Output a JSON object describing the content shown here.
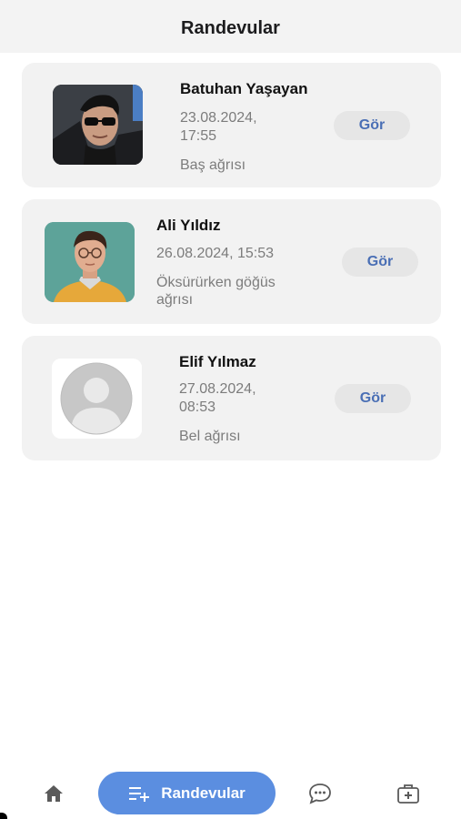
{
  "header": {
    "title": "Randevular"
  },
  "appointments": [
    {
      "name": "Batuhan Yaşayan",
      "datetime_line1": "23.08.2024,",
      "datetime_line2": "17:55",
      "complaint_line1": "Baş ağrısı",
      "complaint_line2": "",
      "button_label": "Gör"
    },
    {
      "name": "Ali Yıldız",
      "datetime_line1": "26.08.2024, 15:53",
      "datetime_line2": "",
      "complaint_line1": "Öksürürken göğüs",
      "complaint_line2": "ağrısı",
      "button_label": "Gör"
    },
    {
      "name": "Elif Yılmaz",
      "datetime_line1": "27.08.2024,",
      "datetime_line2": "08:53",
      "complaint_line1": "Bel ağrısı",
      "complaint_line2": "",
      "button_label": "Gör"
    }
  ],
  "tabbar": {
    "items": [
      {
        "icon": "home-icon"
      },
      {
        "icon": "add-list-icon",
        "label": "Randevular",
        "active": true
      },
      {
        "icon": "chat-bubble-icon"
      },
      {
        "icon": "medical-kit-icon"
      }
    ]
  },
  "colors": {
    "accent": "#5b8ee0",
    "button_text": "#4a6fb5",
    "card_bg": "#f2f2f2",
    "header_bg": "#f3f3f3",
    "secondary_text": "#7c7c7c"
  }
}
